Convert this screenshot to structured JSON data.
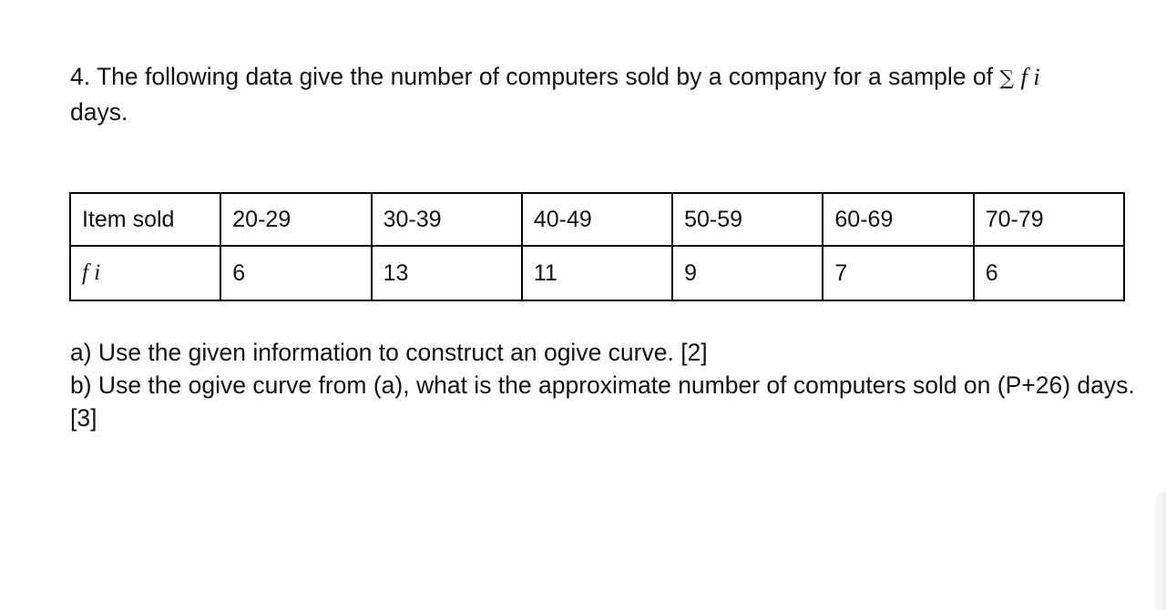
{
  "question": {
    "number": "4.",
    "text": "The following data give the number of computers sold by a company for a sample of",
    "sigma_symbol": "∑",
    "sum_term": "f i",
    "text_end": "days."
  },
  "table": {
    "header_label": "Item sold",
    "row_label": "f i",
    "classes": [
      "20-29",
      "30-39",
      "40-49",
      "50-59",
      "60-69",
      "70-79"
    ],
    "frequencies": [
      "6",
      "13",
      "11",
      "9",
      "7",
      "6"
    ]
  },
  "parts": {
    "a": "a) Use the given information to construct an ogive curve. [2]",
    "b": "b) Use the ogive curve from (a), what is the approximate number of computers sold on (P+26) days. [3]"
  }
}
